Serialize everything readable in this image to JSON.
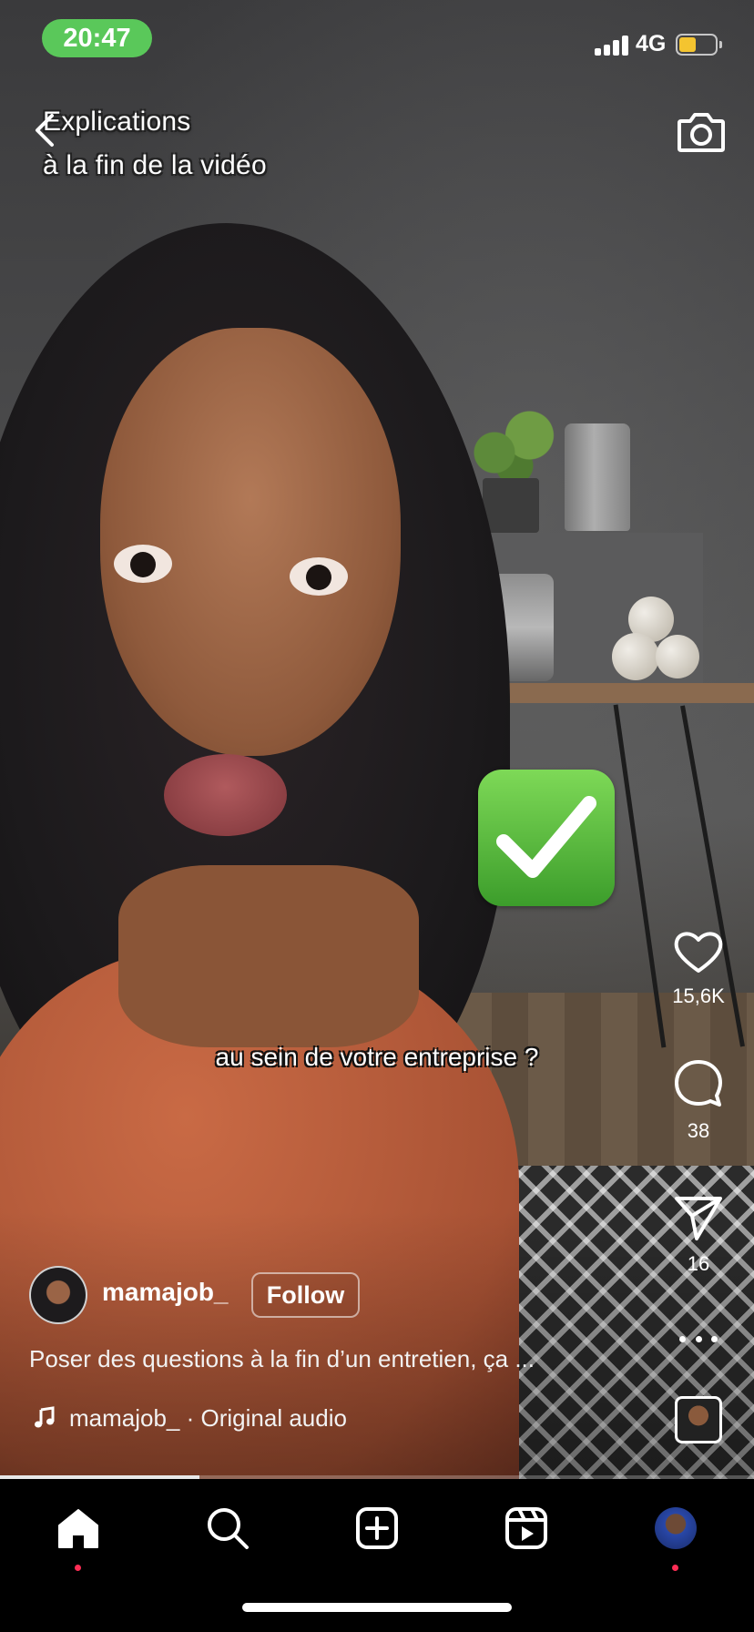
{
  "status_bar": {
    "time": "20:47",
    "network": "4G",
    "battery_color": "#f4c430",
    "time_pill_color": "#5ac85a"
  },
  "video": {
    "overlay_text_line1": "Explications",
    "overlay_text_line2": "à la fin de la vidéo",
    "subtitle": "au sein de votre entreprise ?",
    "emoji": "check-mark-button",
    "progress_fraction": 0.265
  },
  "actions": {
    "likes": "15,6K",
    "comments": "38",
    "shares": "16"
  },
  "author": {
    "username": "mamajob_",
    "follow_label": "Follow"
  },
  "caption": "Poser des questions à la fin d’un entretien, ça ...",
  "audio": {
    "label": "mamajob_ · Original audio"
  },
  "tabbar": {
    "tabs": [
      "home-icon",
      "search-icon",
      "create-icon",
      "reels-icon",
      "profile-avatar"
    ],
    "notification_dot_color": "#ff2d55"
  }
}
